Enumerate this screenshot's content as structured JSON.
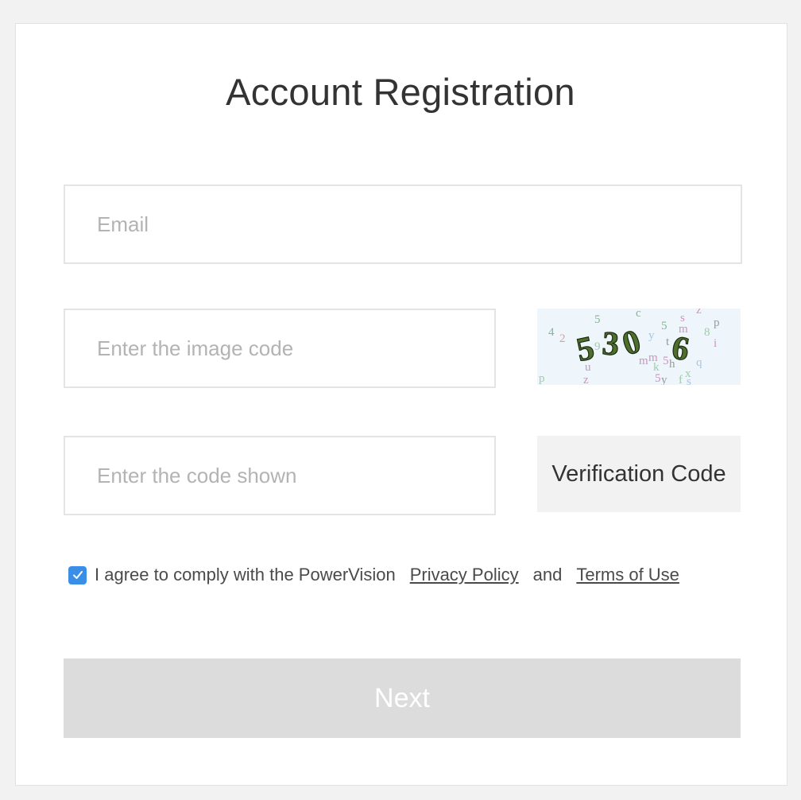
{
  "page": {
    "title": "Account Registration"
  },
  "form": {
    "email_placeholder": "Email",
    "image_code_placeholder": "Enter the image code",
    "code_placeholder": "Enter the code shown",
    "verification_button": "Verification Code",
    "captcha_text": "5306",
    "agree": {
      "checked": true,
      "text": "I agree to comply with the PowerVision",
      "privacy_link": "Privacy Policy",
      "and_text": "and",
      "terms_link": "Terms of Use"
    },
    "next_button": "Next"
  },
  "colors": {
    "background": "#f2f2f2",
    "card": "#ffffff",
    "checkbox": "#3a8ee6",
    "next_button_disabled": "#dcdcdc",
    "verification_button_bg": "#f2f2f2"
  }
}
